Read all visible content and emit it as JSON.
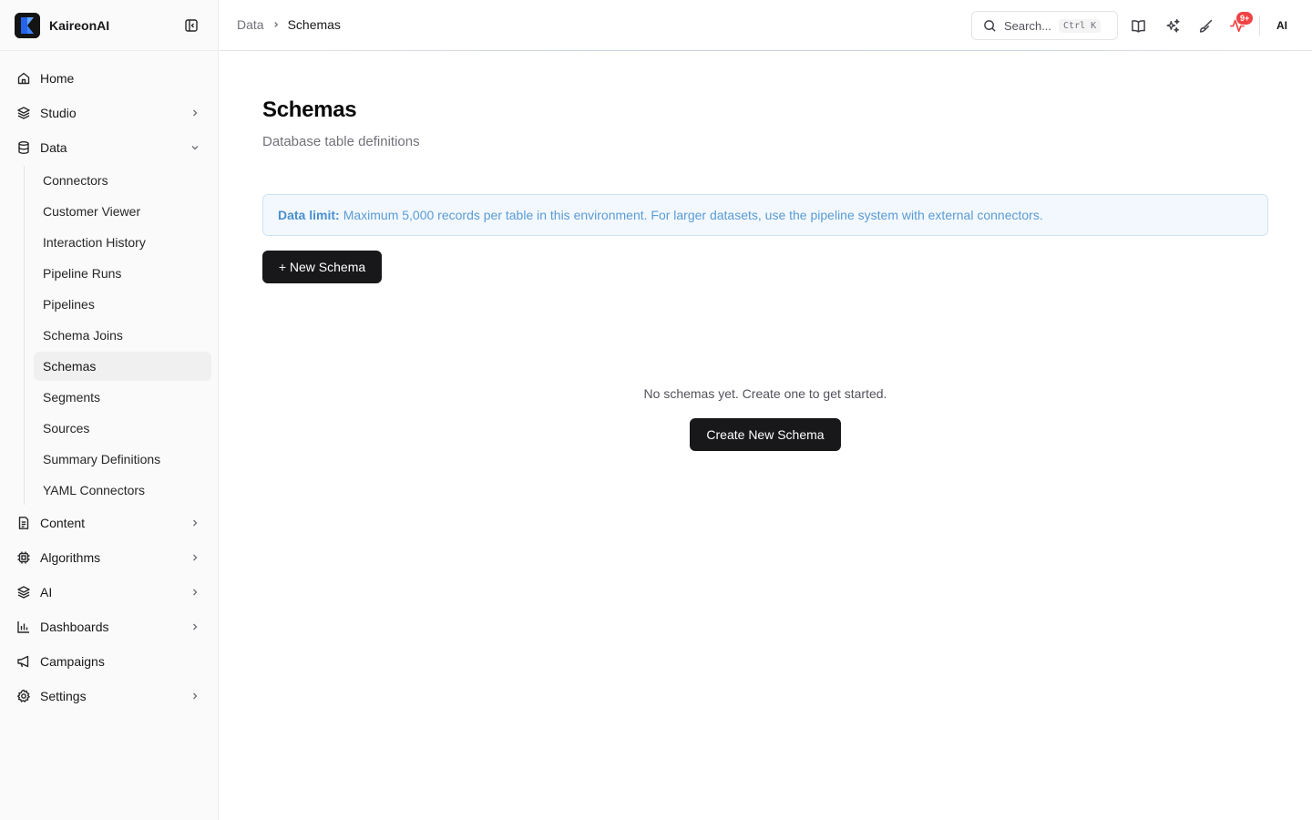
{
  "app": {
    "name": "KaireonAI"
  },
  "sidebar": {
    "items": [
      {
        "label": "Home",
        "icon": "home-icon",
        "chevron": false
      },
      {
        "label": "Studio",
        "icon": "layers-icon",
        "chevron": "right"
      },
      {
        "label": "Data",
        "icon": "database-icon",
        "chevron": "down"
      },
      {
        "label": "Content",
        "icon": "file-text-icon",
        "chevron": "right"
      },
      {
        "label": "Algorithms",
        "icon": "cpu-icon",
        "chevron": "right"
      },
      {
        "label": "AI",
        "icon": "layers-icon",
        "chevron": "right"
      },
      {
        "label": "Dashboards",
        "icon": "bar-chart-icon",
        "chevron": "right"
      },
      {
        "label": "Campaigns",
        "icon": "megaphone-icon",
        "chevron": false
      },
      {
        "label": "Settings",
        "icon": "gear-icon",
        "chevron": "right"
      }
    ],
    "data_subitems": [
      "Connectors",
      "Customer Viewer",
      "Interaction History",
      "Pipeline Runs",
      "Pipelines",
      "Schema Joins",
      "Schemas",
      "Segments",
      "Sources",
      "Summary Definitions",
      "YAML Connectors"
    ],
    "active_subitem": "Schemas"
  },
  "header": {
    "breadcrumb": {
      "parent": "Data",
      "current": "Schemas"
    },
    "search": {
      "label": "Search...",
      "shortcut_key1": "Ctrl",
      "shortcut_key2": "K"
    },
    "notification_badge": "9+",
    "ai_label": "AI"
  },
  "main": {
    "title": "Schemas",
    "subtitle": "Database table definitions",
    "banner": {
      "label": "Data limit:",
      "text": "Maximum 5,000 records per table in this environment. For larger datasets, use the pipeline system with external connectors."
    },
    "new_button": "+ New Schema",
    "empty_message": "No schemas yet. Create one to get started.",
    "create_button": "Create New Schema"
  },
  "colors": {
    "accent_dark": "#18181b",
    "info_bg": "#f2f8fd",
    "info_text": "#5b9bd5",
    "badge_red": "#ef4444"
  }
}
